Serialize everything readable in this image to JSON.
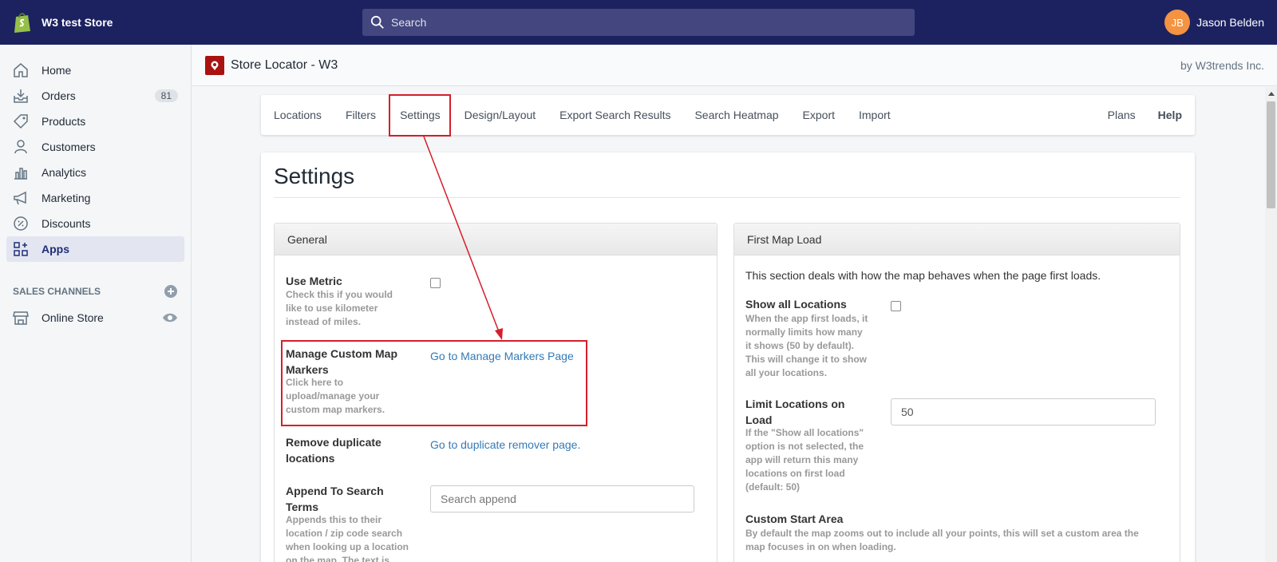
{
  "store": {
    "name": "W3 test Store"
  },
  "search": {
    "placeholder": "Search"
  },
  "user": {
    "initials": "JB",
    "name": "Jason Belden"
  },
  "sidebar": {
    "items": [
      {
        "label": "Home",
        "icon": "home-icon"
      },
      {
        "label": "Orders",
        "icon": "orders-icon",
        "badge": "81"
      },
      {
        "label": "Products",
        "icon": "tag-icon"
      },
      {
        "label": "Customers",
        "icon": "person-icon"
      },
      {
        "label": "Analytics",
        "icon": "bar-chart-icon"
      },
      {
        "label": "Marketing",
        "icon": "megaphone-icon"
      },
      {
        "label": "Discounts",
        "icon": "discount-icon"
      },
      {
        "label": "Apps",
        "icon": "apps-icon",
        "active": true
      }
    ],
    "sales_channels_title": "SALES CHANNELS",
    "online_store": "Online Store"
  },
  "app": {
    "title": "Store Locator - W3",
    "vendor": "by W3trends Inc."
  },
  "tabs": {
    "locations": "Locations",
    "filters": "Filters",
    "settings": "Settings",
    "design": "Design/Layout",
    "export_search": "Export Search Results",
    "heatmap": "Search Heatmap",
    "export": "Export",
    "import": "Import",
    "plans": "Plans",
    "help": "Help"
  },
  "page": {
    "title": "Settings"
  },
  "general": {
    "title": "General",
    "use_metric": {
      "label": "Use Metric",
      "help": "Check this if you would like to use kilometer instead of miles."
    },
    "markers": {
      "label": "Manage Custom Map Markers",
      "help": "Click here to upload/manage your custom map markers.",
      "link": "Go to Manage Markers Page"
    },
    "duplicates": {
      "label": "Remove duplicate locations",
      "link": "Go to duplicate remover page."
    },
    "append": {
      "label": "Append To Search Terms",
      "help": "Appends this to their location / zip code search when looking up a location on the map. The text is",
      "placeholder": "Search append"
    }
  },
  "first_load": {
    "title": "First Map Load",
    "intro": "This section deals with how the map behaves when the page first loads.",
    "show_all": {
      "label": "Show all Locations",
      "help": "When the app first loads, it normally limits how many it shows (50 by default). This will change it to show all your locations."
    },
    "limit": {
      "label": "Limit Locations on Load",
      "help": "If the \"Show all locations\" option is not selected, the app will return this many locations on first load (default: 50)",
      "value": "50"
    },
    "custom_start": {
      "label": "Custom Start Area",
      "help": "By default the map zooms out to include all your points, this will set a custom area the map focuses in on when loading."
    }
  },
  "colors": {
    "topbar": "#1c2260",
    "annotation": "#d41f2a",
    "link": "#337ab7",
    "avatar": "#f49342"
  }
}
